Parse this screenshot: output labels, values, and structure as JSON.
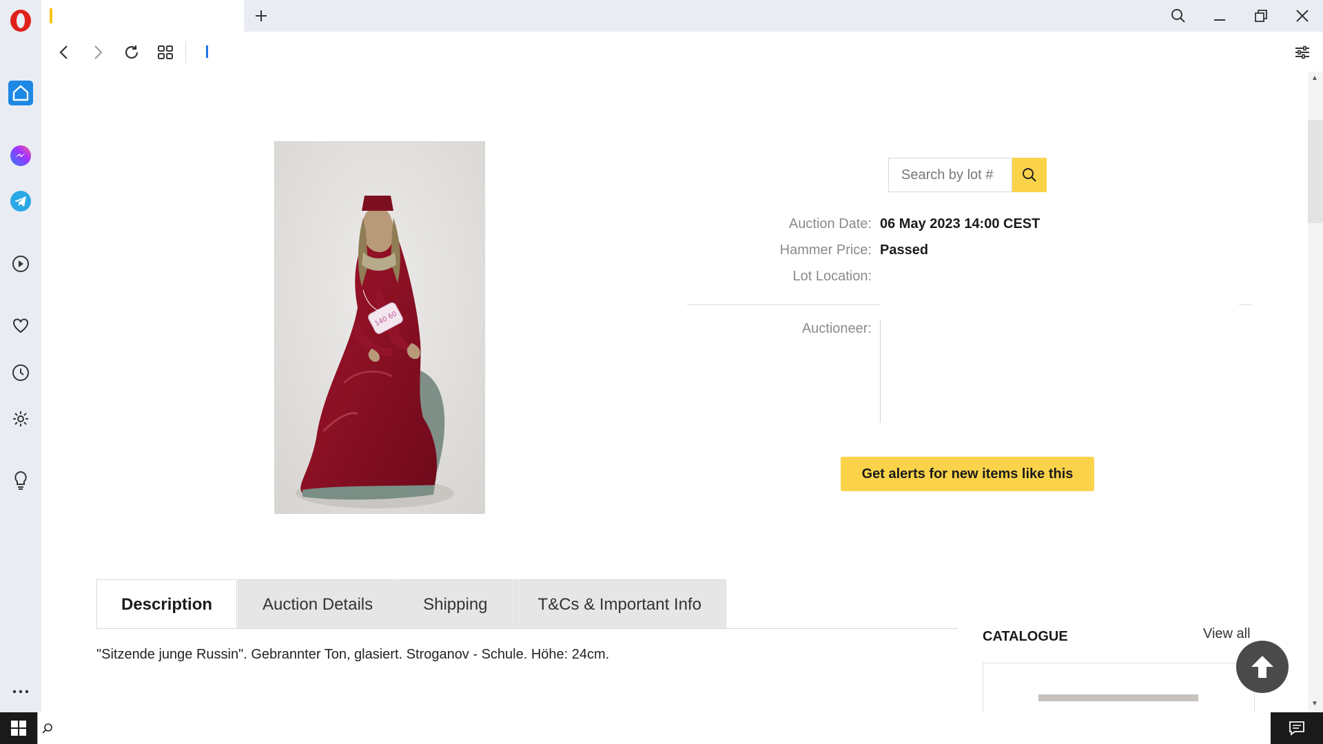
{
  "browser": {
    "active_tab_title": "",
    "address": ""
  },
  "lot": {
    "search_placeholder": "Search by lot #",
    "info": [
      {
        "label": "Auction Date:",
        "value": "06 May 2023 14:00 CEST"
      },
      {
        "label": "Hammer Price:",
        "value": "Passed"
      },
      {
        "label": "Lot Location:",
        "value": ""
      }
    ],
    "auctioneer_label": "Auctioneer:",
    "alert_button": "Get alerts for new items like this",
    "tag_text": "140 60"
  },
  "tabs": [
    {
      "label": "Description",
      "active": true
    },
    {
      "label": "Auction Details",
      "active": false
    },
    {
      "label": "Shipping",
      "active": false
    },
    {
      "label": "T&Cs & Important Info",
      "active": false
    }
  ],
  "description": "\"Sitzende junge Russin\". Gebrannter Ton, glasiert. Stroganov - Schule. Höhe: 24cm.",
  "catalogue": {
    "title": "CATALOGUE",
    "view_all": "View all"
  },
  "icons": {
    "sidebar": [
      "opera-logo",
      "home-icon",
      "messenger-icon",
      "telegram-icon",
      "player-icon",
      "heart-icon",
      "history-icon",
      "settings-icon",
      "lightbulb-icon",
      "more-icon"
    ],
    "nav": [
      "back-icon",
      "forward-icon",
      "reload-icon",
      "tabs-grid-icon"
    ],
    "window": [
      "search-icon",
      "minimize-icon",
      "restore-icon",
      "close-icon"
    ],
    "accent": "#fbd34a",
    "sidebar_home_color": "#1e88e5"
  }
}
